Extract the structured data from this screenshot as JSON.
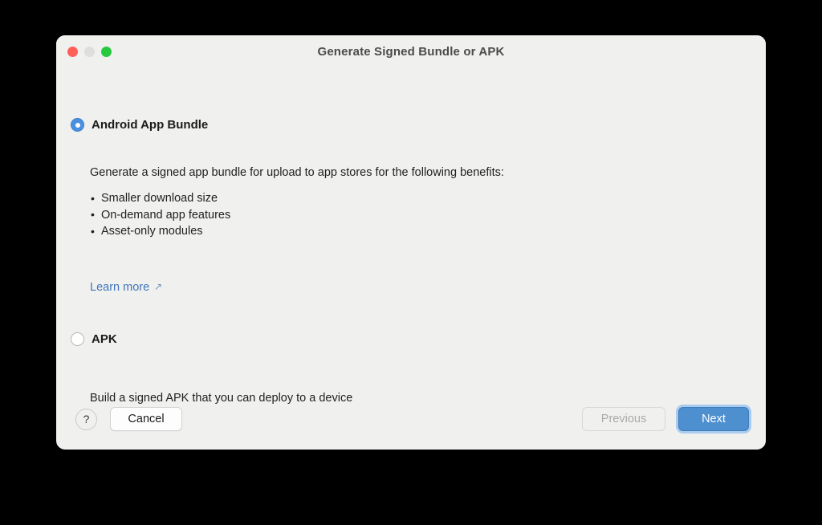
{
  "window": {
    "title": "Generate Signed Bundle or APK",
    "traffic_lights": [
      {
        "name": "close",
        "color": "#ff5f57"
      },
      {
        "name": "minimize",
        "color": "#dedede"
      },
      {
        "name": "zoom",
        "color": "#28c840"
      }
    ]
  },
  "options": {
    "bundle": {
      "label": "Android App Bundle",
      "selected": true,
      "description": "Generate a signed app bundle for upload to app stores for the following benefits:",
      "benefits": [
        "Smaller download size",
        "On-demand app features",
        "Asset-only modules"
      ],
      "learn_more": {
        "label": "Learn more",
        "icon": "external-link-arrow",
        "glyph": "↗",
        "color": "#4076b8"
      }
    },
    "apk": {
      "label": "APK",
      "selected": false,
      "description": "Build a signed APK that you can deploy to a device"
    }
  },
  "footer": {
    "help_label": "?",
    "cancel_label": "Cancel",
    "previous_label": "Previous",
    "previous_disabled": true,
    "next_label": "Next",
    "next_accent_color": "#4e8fd0",
    "next_focus_ring_color": "#a9cbee"
  }
}
